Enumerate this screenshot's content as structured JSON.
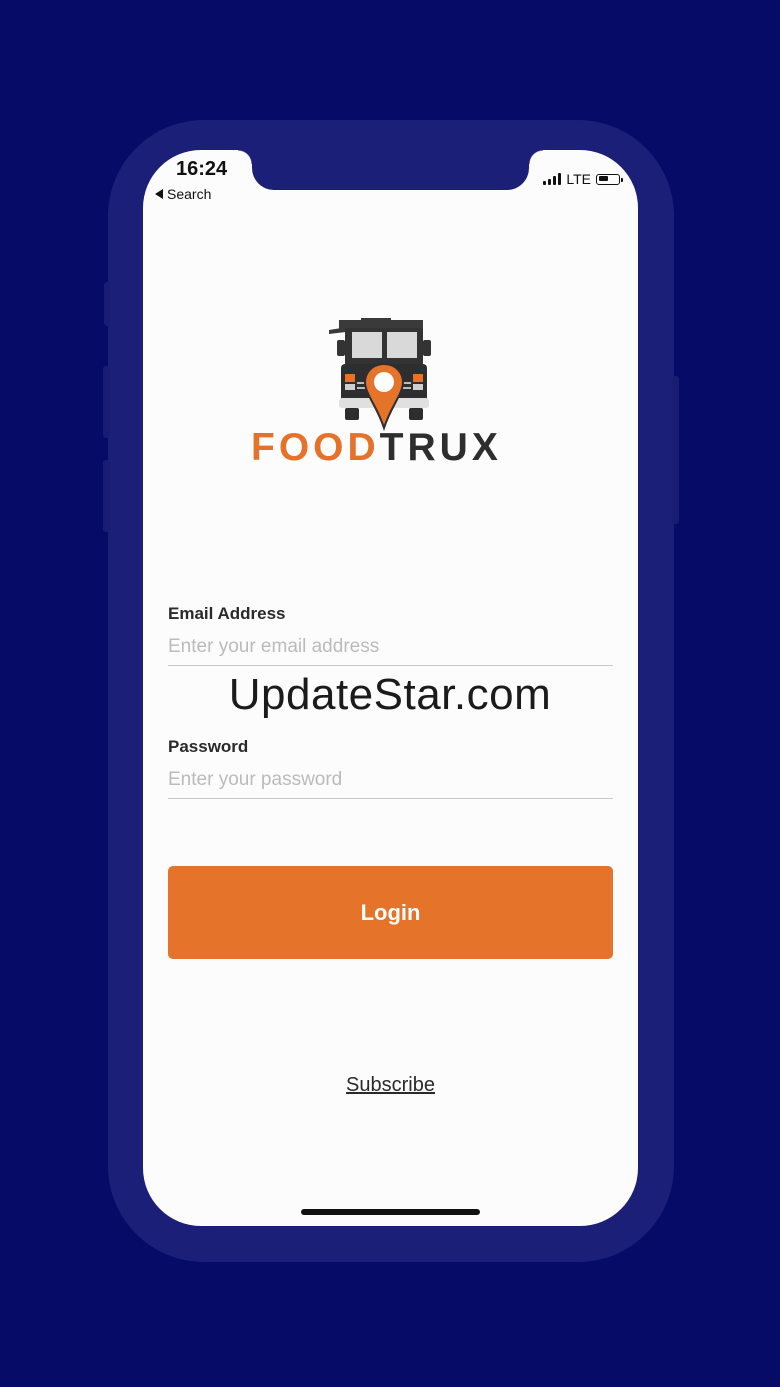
{
  "status_bar": {
    "time": "16:24",
    "back_label": "Search",
    "network": "LTE"
  },
  "logo": {
    "word_part_1": "FOOD",
    "word_part_2": "TRUX"
  },
  "form": {
    "email_label": "Email Address",
    "email_placeholder": "Enter your email address",
    "email_value": "",
    "password_label": "Password",
    "password_placeholder": "Enter your password",
    "password_value": ""
  },
  "actions": {
    "login_label": "Login",
    "subscribe_label": "Subscribe"
  },
  "watermark": "UpdateStar.com",
  "colors": {
    "background": "#050b66",
    "phone_frame": "#1b1f78",
    "accent_orange": "#e5732a",
    "truck_dark": "#2e2e2e"
  }
}
